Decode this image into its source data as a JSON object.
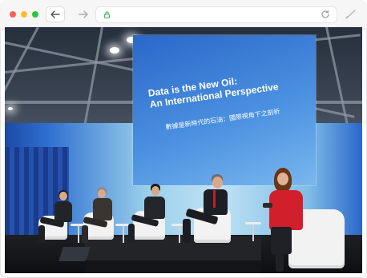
{
  "colors": {
    "close_dot": "#ff5f57",
    "minimize_dot": "#febc2e",
    "zoom_dot": "#28c840",
    "lock_icon": "#2ea84a",
    "screen_blue": "#3f7fd6",
    "speaker_red": "#d11f2c"
  },
  "icons": {
    "back": "arrow-left",
    "forward": "arrow-right",
    "lock": "lock",
    "reload": "reload",
    "extension": "pen"
  },
  "photo": {
    "screen_title": "Data is the New Oil:",
    "screen_subtitle": "An International Perspective",
    "screen_chinese": "數據是新時代的石油：國際視角下之剖析"
  }
}
